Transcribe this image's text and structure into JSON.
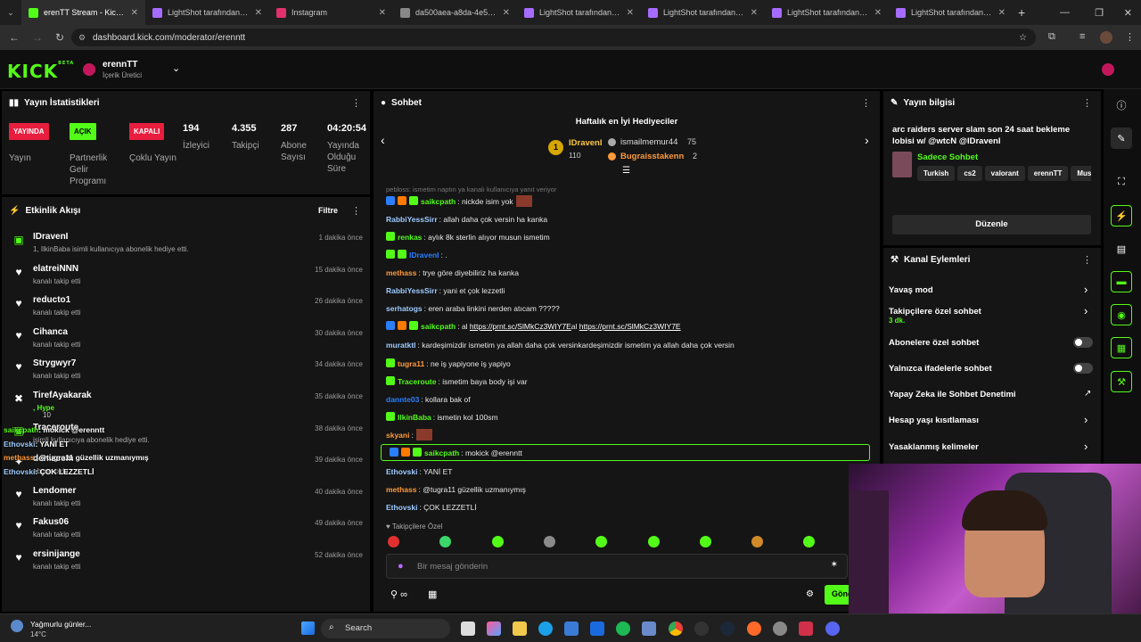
{
  "browser": {
    "tabs": [
      {
        "label": "erenTT Stream - Kick Da",
        "icon": "kick-icon",
        "color": "#53fc18",
        "active": true
      },
      {
        "label": "LightShot tarafından Ekra",
        "icon": "lightshot-icon",
        "color": "#a66cff"
      },
      {
        "label": "Instagram",
        "icon": "instagram-icon",
        "color": "#e1306c"
      },
      {
        "label": "da500aea-a8da-4e53-9b6",
        "icon": "globe-icon",
        "color": "#888"
      },
      {
        "label": "LightShot tarafından Ekra",
        "icon": "lightshot-icon",
        "color": "#a66cff"
      },
      {
        "label": "LightShot tarafından Ekra",
        "icon": "lightshot-icon",
        "color": "#a66cff"
      },
      {
        "label": "LightShot tarafından Ekra",
        "icon": "lightshot-icon",
        "color": "#a66cff"
      },
      {
        "label": "LightShot tarafından Ekra",
        "icon": "lightshot-icon",
        "color": "#a66cff"
      }
    ],
    "url": "dashboard.kick.com/moderator/erenntt"
  },
  "header": {
    "logo": "KICK",
    "logo_sup": "BETA",
    "channel_name": "erennTT",
    "channel_role": "İçerik Üretici"
  },
  "stats": {
    "title": "Yayın İstatistikleri",
    "items": [
      {
        "badge": "YAYINDA",
        "badge_color": "#e91e3f",
        "label": "Yayın"
      },
      {
        "badge": "AÇIK",
        "badge_color": "#53fc18",
        "label": "Partnerlik Gelir Programı"
      },
      {
        "badge": "KAPALI",
        "badge_color": "#e91e3f",
        "label": "Çoklu Yayın"
      },
      {
        "value": "194",
        "label": "İzleyici"
      },
      {
        "value": "4.355",
        "label": "Takipçi"
      },
      {
        "value": "287",
        "label": "Abone Sayısı"
      },
      {
        "value": "04:20:54",
        "label": "Yayında Olduğu Süre"
      }
    ]
  },
  "activity": {
    "title": "Etkinlik Akışı",
    "filter": "Filtre",
    "items": [
      {
        "name": "IDravenI",
        "sub": "1, IlkinBaba isimli kullanıcıya abonelik hediye etti.",
        "time": "1 dakika önce",
        "icon": "gift-icon"
      },
      {
        "name": "elatreiNNN",
        "sub": "kanalı takip etti",
        "time": "15 dakika önce",
        "icon": "heart-icon"
      },
      {
        "name": "reducto1",
        "sub": "kanalı takip etti",
        "time": "26 dakika önce",
        "icon": "heart-icon"
      },
      {
        "name": "Cihanca",
        "sub": "kanalı takip etti",
        "time": "30 dakika önce",
        "icon": "heart-icon"
      },
      {
        "name": "Strygwyr7",
        "sub": "kanalı takip etti",
        "time": "34 dakika önce",
        "icon": "heart-icon"
      },
      {
        "name": "TirefAyakarak",
        "sub": ", Hype",
        "time": "35 dakika önce",
        "icon": "kick-icon",
        "extra": "10"
      },
      {
        "name": "Traceroute",
        "sub": "isimli kullanıcıya abonelik hediye etti.",
        "time": "38 dakika önce",
        "icon": "gift-icon"
      },
      {
        "name": "denizcem",
        "sub": "abone oldu",
        "time": "39 dakika önce",
        "icon": "star-icon"
      },
      {
        "name": "Lendomer",
        "sub": "kanalı takip etti",
        "time": "40 dakika önce",
        "icon": "heart-icon"
      },
      {
        "name": "Fakus06",
        "sub": "kanalı takip etti",
        "time": "49 dakika önce",
        "icon": "heart-icon"
      },
      {
        "name": "ersinijange",
        "sub": "kanalı takip etti",
        "time": "52 dakika önce",
        "icon": "heart-icon"
      }
    ],
    "overlay": [
      {
        "user": "saikcpath",
        "text": ": mokick @erenntt",
        "color": "#53fc18"
      },
      {
        "user": "Ethovski",
        "text": ": YANİ ET",
        "color": "#9ecbff"
      },
      {
        "user": "methass",
        "text": ": @tugra11 güzellik uzmanıymış",
        "color": "#ff9a3c"
      },
      {
        "user": "Ethovski",
        "text": ": ÇOK LEZZETLİ",
        "color": "#9ecbff"
      }
    ]
  },
  "chat": {
    "title": "Sohbet",
    "gifters_title": "Haftalık en İyi Hediyeciler",
    "gifters": [
      {
        "rank": "1",
        "name": "IDravenI",
        "count": "110"
      },
      {
        "name": "ismailmemur44",
        "count": "75"
      },
      {
        "name": "Bugraisstakenn",
        "count": "2"
      }
    ],
    "reply_hint": "pebloss: ismetim naptın ya kanalı kullanıcıya yanıt veriyor",
    "messages": [
      {
        "user": "saikcpath",
        "text": ": nickde isim yok",
        "color": "#53fc18",
        "badges": [
          "#2a7fff",
          "#ff7a00",
          "#53fc18"
        ]
      },
      {
        "user": "RabbiYessSirr",
        "text": ": allah daha çok versin ha kanka",
        "color": "#9ecbff",
        "badges": []
      },
      {
        "user": "renkas",
        "text": ": aylık 8k sterlin alıyor musun ismetim",
        "color": "#53fc18",
        "badges": [
          "#53fc18"
        ]
      },
      {
        "user": "IDravenI",
        "text": ": .",
        "color": "#2a7fff",
        "badges": [
          "#53fc18",
          "#53fc18"
        ]
      },
      {
        "user": "methass",
        "text": ": trye göre diyebiliriz ha kanka",
        "color": "#ff9a3c",
        "badges": []
      },
      {
        "user": "RabbiYessSirr",
        "text": ": yani et çok lezzetli",
        "color": "#9ecbff",
        "badges": []
      },
      {
        "user": "serhatogs",
        "text": ": eren araba linkini nerden atıcam ?????",
        "color": "#9ecbff",
        "badges": []
      },
      {
        "user": "saikcpath",
        "text": ": al ",
        "link1": "https://prnt.sc/SlMkCz3WIY7E",
        "mid": "al ",
        "link2": "https://prnt.sc/SlMkCz3WIY7E",
        "color": "#53fc18",
        "badges": [
          "#2a7fff",
          "#ff7a00",
          "#53fc18"
        ]
      },
      {
        "user": "muratktl",
        "text": ": kardeşimizdir ismetim ya allah daha çok versinkardeşimizdir ismetim ya allah daha çok versin",
        "color": "#9ecbff",
        "badges": []
      },
      {
        "user": "tugra11",
        "text": ": ne iş yapiyone iş yapiyo",
        "color": "#ff9a3c",
        "badges": [
          "#53fc18"
        ]
      },
      {
        "user": "Traceroute",
        "text": ": ismetim baya body işi var",
        "color": "#53fc18",
        "badges": [
          "#53fc18"
        ]
      },
      {
        "user": "dannte03",
        "text": ": kollara bak of",
        "color": "#2a7fff",
        "badges": []
      },
      {
        "user": "IlkinBaba",
        "text": ": ismetin kol 100sm",
        "color": "#53fc18",
        "badges": [
          "#53fc18"
        ]
      },
      {
        "user": "skyani",
        "text": ":",
        "color": "#ff9a3c",
        "badges": []
      },
      {
        "user": "saikcpath",
        "text": ": mokick @erenntt",
        "color": "#53fc18",
        "badges": [
          "#2a7fff",
          "#ff7a00",
          "#53fc18"
        ],
        "highlight": true
      },
      {
        "user": "Ethovski",
        "text": ": YANİ ET",
        "color": "#9ecbff",
        "badges": []
      },
      {
        "user": "methass",
        "text": ": @tugra11 güzellik uzmanıymış",
        "color": "#ff9a3c",
        "badges": []
      },
      {
        "user": "Ethovski",
        "text": ": ÇOK LEZZETLİ",
        "color": "#9ecbff",
        "badges": []
      }
    ],
    "followers_label": "Takipçilere Özel",
    "input_placeholder": "Bir mesaj gönderin",
    "send_label": "Gönder"
  },
  "stream_info": {
    "title": "Yayın bilgisi",
    "stream_title": "arc raiders server slam son 24 saat bekleme lobisi w/ @wtcN @IDravenI",
    "category": "Sadece Sohbet",
    "tags": [
      "Turkish",
      "cs2",
      "valorant",
      "erennTT",
      "Music"
    ],
    "edit_label": "Düzenle"
  },
  "channel_actions": {
    "title": "Kanal Eylemleri",
    "items": [
      {
        "label": "Yavaş mod",
        "type": "chevron"
      },
      {
        "label": "Takipçilere özel sohbet",
        "sub": "3 dk.",
        "type": "chevron"
      },
      {
        "label": "Abonelere özel sohbet",
        "type": "toggle"
      },
      {
        "label": "Yalnızca ifadelerle sohbet",
        "type": "toggle"
      },
      {
        "label": "Yapay Zeka ile Sohbet Denetimi",
        "type": "external"
      },
      {
        "label": "Hesap yaşı kısıtlaması",
        "type": "chevron"
      },
      {
        "label": "Yasaklanmış kelimeler",
        "type": "chevron"
      }
    ]
  },
  "taskbar": {
    "weather": "Yağmurlu günler...",
    "temp": "14°C",
    "search": "Search"
  }
}
